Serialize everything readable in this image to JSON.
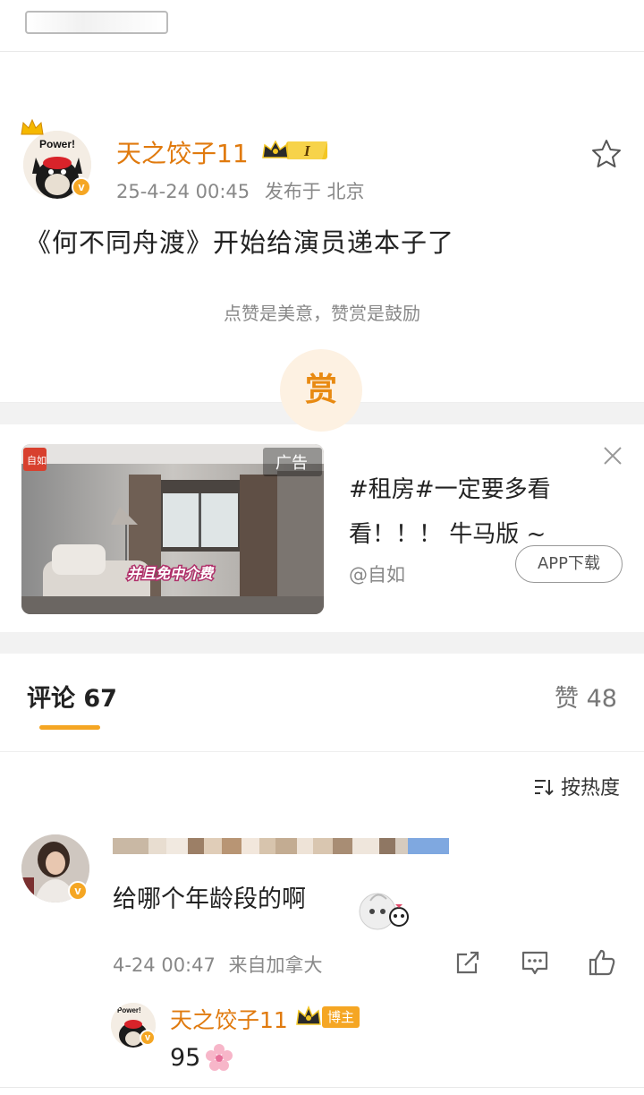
{
  "post": {
    "author": "天之饺子11",
    "level_badge": "I",
    "avatar_caption": "Power!",
    "timestamp": "25-4-24 00:45",
    "location": "发布于 北京",
    "text": "《何不同舟渡》开始给演员递本子了",
    "reward_hint": "点赞是美意，赞赏是鼓励",
    "reward_label": "赏"
  },
  "ad": {
    "tag": "广告",
    "brand_logo": "自如",
    "overlay": "并且免中介费",
    "title": "#租房#一定要多看看！！！ 牛马版 ~",
    "source": "@自如",
    "cta": "APP下载"
  },
  "tabs": {
    "comments": "评论 67",
    "likes": "赞 48"
  },
  "sort_label": "按热度",
  "comment": {
    "text": "给哪个年龄段的啊",
    "timestamp": "4-24 00:47",
    "location": "来自加拿大"
  },
  "reply": {
    "author": "天之饺子11",
    "badge": "博主",
    "avatar_caption": "Power!",
    "text": "95"
  },
  "colors": {
    "accent": "#f5a623",
    "username": "#e07a0e",
    "muted": "#888888"
  },
  "icons": [
    "star-icon",
    "close-icon",
    "sort-icon",
    "share-icon",
    "comment-icon",
    "like-icon",
    "crown-icon",
    "flower-icon"
  ]
}
